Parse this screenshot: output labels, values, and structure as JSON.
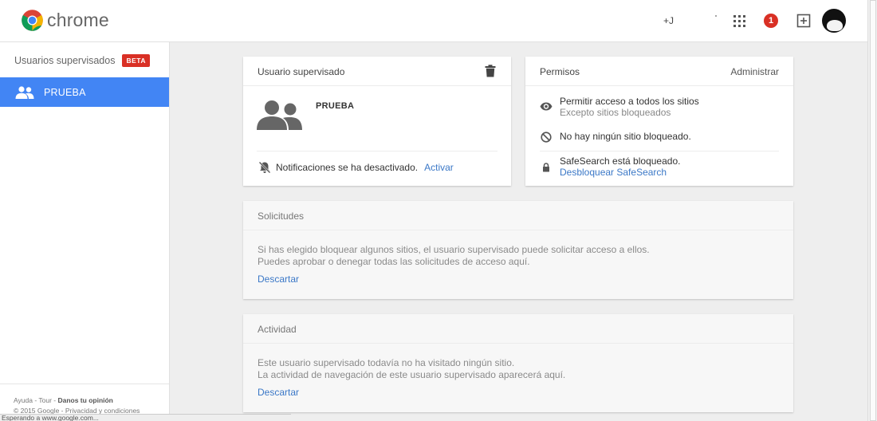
{
  "header": {
    "app_name": "chrome",
    "plus_user": "+J",
    "notification_count": "1",
    "brand_colors": {
      "blue": "#4285f4",
      "red": "#db4437",
      "yellow": "#f4b400",
      "green": "#0f9d58"
    }
  },
  "sidebar": {
    "title": "Usuarios supervisados",
    "badge": "BETA",
    "items": [
      {
        "label": "PRUEBA",
        "icon": "people-icon",
        "selected": true
      }
    ],
    "footer": {
      "help": "Ayuda",
      "tour": "Tour",
      "feedback": "Danos tu opinión",
      "copyright": "© 2015 Google",
      "privacy": "Privacidad y condiciones",
      "sep": " - "
    }
  },
  "status_bar": {
    "text": "Esperando a www.google.com..."
  },
  "user_card": {
    "title": "Usuario supervisado",
    "name": "PRUEBA",
    "notifications_text": "Notificaciones se ha desactivado.",
    "activate_link": "Activar"
  },
  "permissions_card": {
    "title": "Permisos",
    "manage": "Administrar",
    "allow_all": "Permitir acceso a todos los sitios",
    "except": "Excepto sitios bloqueados",
    "no_blocked": "No hay ningún sitio bloqueado.",
    "safesearch": "SafeSearch está bloqueado.",
    "unlock_safesearch": "Desbloquear SafeSearch"
  },
  "requests_card": {
    "title": "Solicitudes",
    "line1": "Si has elegido bloquear algunos sitios, el usuario supervisado puede solicitar acceso a ellos.",
    "line2": "Puedes aprobar o denegar todas las solicitudes de acceso aquí.",
    "dismiss": "Descartar"
  },
  "activity_card": {
    "title": "Actividad",
    "line1": "Este usuario supervisado todavía no ha visitado ningún sitio.",
    "line2": "La actividad de navegación de este usuario supervisado aparecerá aquí.",
    "dismiss": "Descartar"
  }
}
